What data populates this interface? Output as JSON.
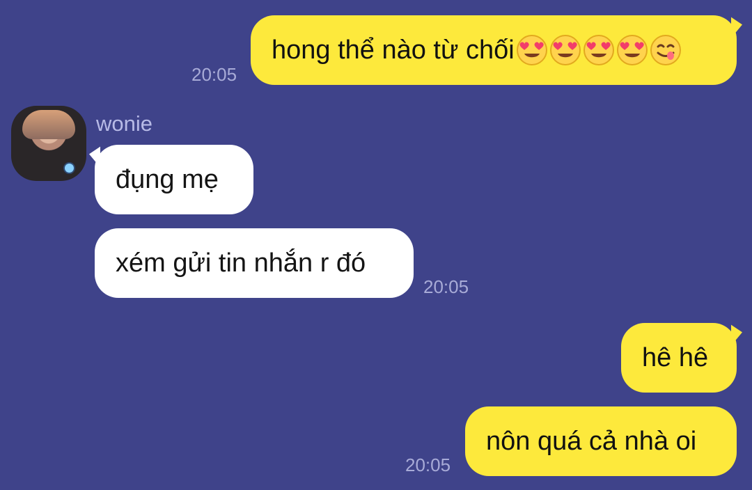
{
  "messages": [
    {
      "text": "hong thể nào từ chối",
      "time": "20:05",
      "emojis": [
        "heart-eyes-emoji",
        "heart-eyes-emoji",
        "heart-eyes-emoji",
        "heart-eyes-emoji",
        "yum-emoji"
      ]
    },
    {
      "sender": "wonie",
      "text": "đụng mẹ"
    },
    {
      "text": "xém gửi tin nhắn r đó",
      "time": "20:05"
    },
    {
      "text": "hê hê"
    },
    {
      "text": "nôn quá cả nhà oi",
      "time": "20:05"
    }
  ],
  "colors": {
    "background": "#3f438a",
    "outgoing_bubble": "#fde93c",
    "incoming_bubble": "#ffffff",
    "timestamp": "#a8abd7",
    "sender_name": "#b7bae6"
  }
}
